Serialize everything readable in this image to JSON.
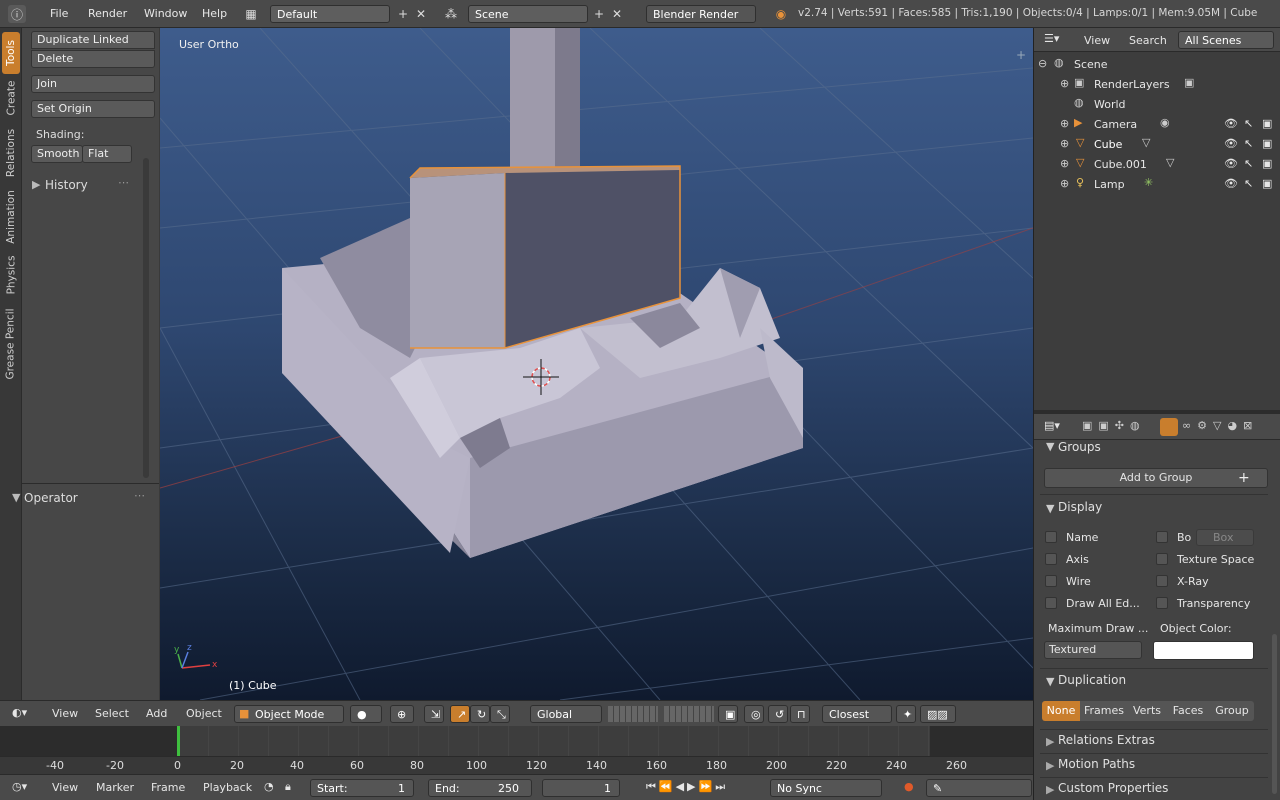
{
  "topbar": {
    "menus": [
      "File",
      "Render",
      "Window",
      "Help"
    ],
    "layout": "Default",
    "scene": "Scene",
    "engine": "Blender Render",
    "stats": "v2.74 | Verts:591 | Faces:585 | Tris:1,190 | Objects:0/4 | Lamps:0/1 | Mem:9.05M | Cube"
  },
  "vtabs": [
    "Tools",
    "Create",
    "Relations",
    "Animation",
    "Physics",
    "Grease Pencil"
  ],
  "toolshelf": {
    "buttons": [
      "Duplicate Linked",
      "Delete",
      "Join",
      "Set Origin"
    ],
    "shading_label": "Shading:",
    "smooth": "Smooth",
    "flat": "Flat",
    "history": "History",
    "operator": "Operator"
  },
  "viewport": {
    "view_label": "User Ortho",
    "object_label": "(1) Cube"
  },
  "view3d_header": {
    "menus": [
      "View",
      "Select",
      "Add",
      "Object"
    ],
    "mode": "Object Mode",
    "orientation": "Global",
    "snap": "Closest"
  },
  "timeline": {
    "ticks": [
      "-40",
      "-20",
      "0",
      "20",
      "40",
      "60",
      "80",
      "100",
      "120",
      "140",
      "160",
      "180",
      "200",
      "220",
      "240",
      "260"
    ],
    "menus": [
      "View",
      "Marker",
      "Frame",
      "Playback"
    ],
    "start_label": "Start:",
    "start": "1",
    "end_label": "End:",
    "end": "250",
    "current": "1",
    "sync": "No Sync"
  },
  "outliner": {
    "tabs": [
      "View",
      "Search",
      "All Scenes"
    ],
    "items": [
      "Scene",
      "RenderLayers",
      "World",
      "Camera",
      "Cube",
      "Cube.001",
      "Lamp"
    ]
  },
  "properties": {
    "groups": "Groups",
    "add_to_group": "Add to Group",
    "display": "Display",
    "checks": [
      "Name",
      "Axis",
      "Wire",
      "Draw All Ed...",
      "Bo",
      "Texture Space",
      "X-Ray",
      "Transparency"
    ],
    "bounds_type": "Box",
    "max_draw_label": "Maximum Draw ...",
    "object_color_label": "Object Color:",
    "draw_type": "Textured",
    "duplication": "Duplication",
    "dup_options": [
      "None",
      "Frames",
      "Verts",
      "Faces",
      "Group"
    ],
    "collapsed": [
      "Relations Extras",
      "Motion Paths",
      "Custom Properties"
    ]
  },
  "colors": {
    "accent": "#c97e2d",
    "selected_outline": "#e8923a",
    "current_frame": "#3fbf3f"
  }
}
